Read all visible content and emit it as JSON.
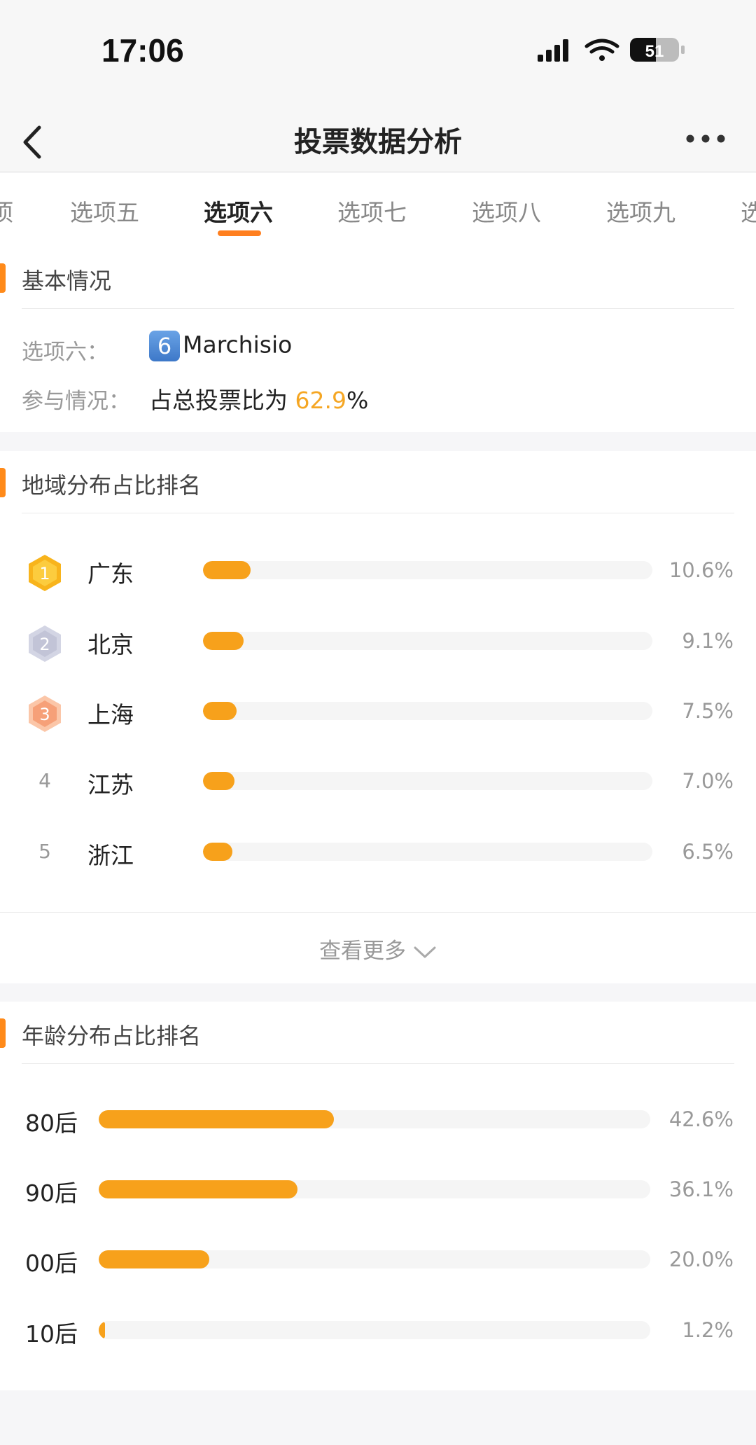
{
  "status_bar": {
    "time": "17:06",
    "battery": "51"
  },
  "nav": {
    "title": "投票数据分析"
  },
  "tabs": [
    {
      "label": "项"
    },
    {
      "label": "选项五"
    },
    {
      "label": "选项六",
      "active": true
    },
    {
      "label": "选项七"
    },
    {
      "label": "选项八"
    },
    {
      "label": "选项九"
    },
    {
      "label": "选"
    }
  ],
  "basic": {
    "title": "基本情况",
    "option_label": "选项六：",
    "option_keycap": "6",
    "option_name": "Marchisio",
    "participation_label": "参与情况：",
    "participation_prefix": "占总投票比为 ",
    "participation_value": "62.9",
    "participation_suffix": "%"
  },
  "region": {
    "title": "地域分布占比排名",
    "rows": [
      {
        "rank": "1",
        "name": "广东",
        "pct": "10.6%",
        "value": 10.6
      },
      {
        "rank": "2",
        "name": "北京",
        "pct": "9.1%",
        "value": 9.1
      },
      {
        "rank": "3",
        "name": "上海",
        "pct": "7.5%",
        "value": 7.5
      },
      {
        "rank": "4",
        "name": "江苏",
        "pct": "7.0%",
        "value": 7.0
      },
      {
        "rank": "5",
        "name": "浙江",
        "pct": "6.5%",
        "value": 6.5
      }
    ],
    "more_label": "查看更多"
  },
  "age": {
    "title": "年龄分布占比排名",
    "rows": [
      {
        "name": "80后",
        "pct": "42.6%",
        "value": 42.6
      },
      {
        "name": "90后",
        "pct": "36.1%",
        "value": 36.1
      },
      {
        "name": "00后",
        "pct": "20.0%",
        "value": 20.0
      },
      {
        "name": "10后",
        "pct": "1.2%",
        "value": 1.2
      }
    ]
  },
  "colors": {
    "accent": "#ff8a1a",
    "bar": "#f7a11b",
    "highlight": "#f5a623",
    "gold": "#f8b41c",
    "silver": "#c9cbdc",
    "bronze": "#f7a47d"
  }
}
